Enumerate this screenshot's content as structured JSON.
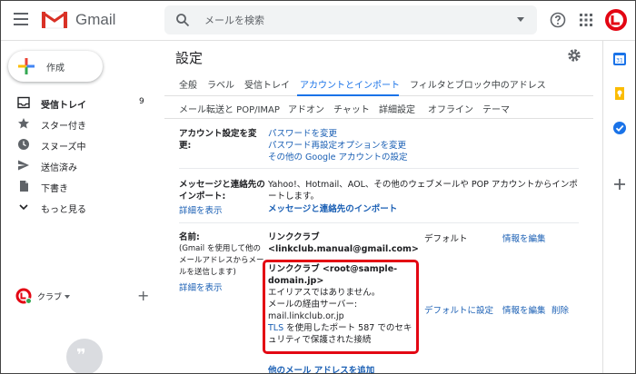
{
  "header": {
    "brand": "Gmail",
    "search_placeholder": "メールを検索"
  },
  "sidebar": {
    "compose_label": "作成",
    "items": [
      {
        "label": "受信トレイ",
        "count": "9",
        "icon": "inbox-icon"
      },
      {
        "label": "スター付き",
        "icon": "star-icon"
      },
      {
        "label": "スヌーズ中",
        "icon": "clock-icon"
      },
      {
        "label": "送信済み",
        "icon": "send-icon"
      },
      {
        "label": "下書き",
        "icon": "draft-icon"
      },
      {
        "label": "もっと見る",
        "icon": "chevron-down-icon"
      }
    ],
    "account_label": "クラブ",
    "add_label": "+"
  },
  "main": {
    "title": "設定",
    "tabs_row1": [
      "全般",
      "ラベル",
      "受信トレイ",
      "アカウントとインポート",
      "フィルタとブロック中のアドレス"
    ],
    "tabs_row2": [
      "メール転送と POP/IMAP",
      "アドオン",
      "チャット",
      "詳細設定",
      "オフライン",
      "テーマ"
    ],
    "account_section": {
      "label": "アカウント設定を変更:",
      "links": [
        "パスワードを変更",
        "パスワード再設定オプションを変更",
        "その他の Google アカウントの設定"
      ]
    },
    "import_section": {
      "label": "メッセージと連絡先のインポート:",
      "help_link": "詳細を表示",
      "text": "Yahoo!、Hotmail、AOL、その他のウェブメールや POP アカウントからインポートします。",
      "action_link": "メッセージと連絡先のインポート"
    },
    "name_section": {
      "label": "名前:",
      "note": "(Gmail を使用して他のメールアドレスからメールを送信します)",
      "help_link": "詳細を表示",
      "primary_name": "リンククラブ",
      "primary_email": "<linkclub.manual@gmail.com>",
      "default_text": "デフォルト",
      "edit_link_1": "情報を編集",
      "secondary_name": "リンククラブ <root@sample-domain.jp>",
      "alias_text": "エイリアスではありません。",
      "server_label": "メールの経由サーバー:",
      "server_host": "mail.linkclub.or.jp",
      "tls_prefix": "TLS",
      "tls_text": " を使用したポート 587 でのセキュリティで保護された接続",
      "make_default_link": "デフォルトに設定",
      "edit_link_2": "情報を編集",
      "delete_link": "削除",
      "add_link": "他のメール アドレスを追加"
    }
  },
  "colors": {
    "accent": "#1a73e8",
    "link": "#1a5fb4",
    "highlight": "#e30613"
  }
}
